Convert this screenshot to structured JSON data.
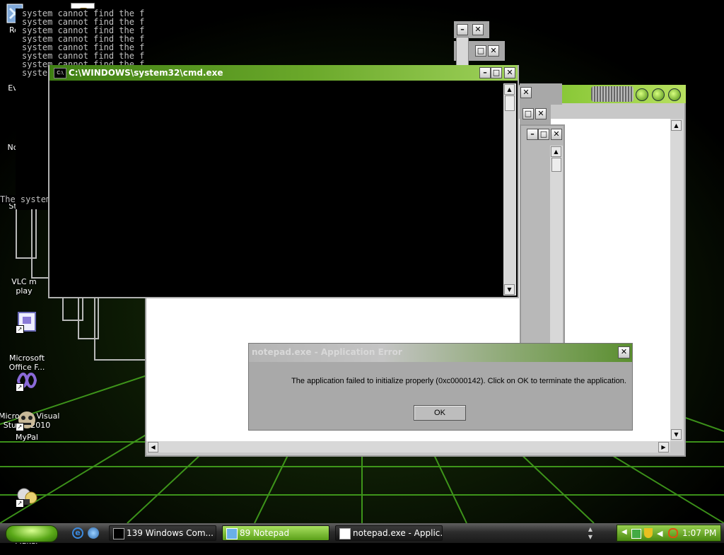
{
  "desktop": {
    "icons": [
      {
        "label": "Re",
        "icon": "recycle-bin-icon"
      },
      {
        "label": "Ev",
        "icon": "everything-icon"
      },
      {
        "label": "No",
        "icon": "notepad-icon"
      },
      {
        "label": "St",
        "icon": "start-icon"
      },
      {
        "label": "VLC m\nplay",
        "icon": "vlc-icon"
      },
      {
        "label": "Microsoft\nOffice F...",
        "icon": "office-icon"
      },
      {
        "label": "Microsoft Visual\nStudio 2010",
        "icon": "visual-studio-icon"
      },
      {
        "label": "MyPal",
        "icon": "mypal-icon"
      },
      {
        "label": "Windows Movie\nMaker",
        "icon": "movie-maker-icon"
      }
    ]
  },
  "console_back": {
    "lines": [
      "system cannot find the file run.exe.",
      "system cannot find the file supermium.exe.",
      "system cannot find the file run.exe.",
      "system cannot find the file supermium.exe.",
      "system cannot find the file run.exe.",
      "system cannot find the file supermium.exe.",
      "system cannot find the file run.exe.",
      "syste"
    ],
    "error_line": "The system cannot execute"
  },
  "cmd_window": {
    "title": "C:\\WINDOWS\\system32\\cmd.exe",
    "icon_label": "C:\\"
  },
  "dialog": {
    "title": "notepad.exe - Application Error",
    "message": "The application failed to initialize properly (0xc0000142). Click on OK to terminate the application.",
    "ok_label": "OK"
  },
  "taskbar": {
    "tasks": [
      {
        "label": "139 Windows Com...",
        "icon": "cmd-icon"
      },
      {
        "label": "89 Notepad",
        "icon": "notepad-icon"
      },
      {
        "label": "notepad.exe - Applic...",
        "icon": "window-icon"
      }
    ],
    "clock": "1:07 PM"
  },
  "colors": {
    "accent_green": "#6aa82a",
    "dialog_gray": "#a9a9a9",
    "console_text": "#c0c0c0"
  }
}
